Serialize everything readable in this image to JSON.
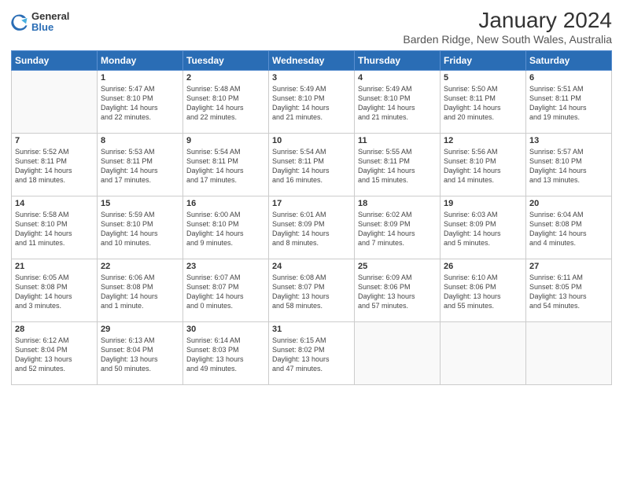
{
  "header": {
    "logo_general": "General",
    "logo_blue": "Blue",
    "title": "January 2024",
    "subtitle": "Barden Ridge, New South Wales, Australia"
  },
  "days_of_week": [
    "Sunday",
    "Monday",
    "Tuesday",
    "Wednesday",
    "Thursday",
    "Friday",
    "Saturday"
  ],
  "weeks": [
    [
      {
        "day": "",
        "info": ""
      },
      {
        "day": "1",
        "info": "Sunrise: 5:47 AM\nSunset: 8:10 PM\nDaylight: 14 hours\nand 22 minutes."
      },
      {
        "day": "2",
        "info": "Sunrise: 5:48 AM\nSunset: 8:10 PM\nDaylight: 14 hours\nand 22 minutes."
      },
      {
        "day": "3",
        "info": "Sunrise: 5:49 AM\nSunset: 8:10 PM\nDaylight: 14 hours\nand 21 minutes."
      },
      {
        "day": "4",
        "info": "Sunrise: 5:49 AM\nSunset: 8:10 PM\nDaylight: 14 hours\nand 21 minutes."
      },
      {
        "day": "5",
        "info": "Sunrise: 5:50 AM\nSunset: 8:11 PM\nDaylight: 14 hours\nand 20 minutes."
      },
      {
        "day": "6",
        "info": "Sunrise: 5:51 AM\nSunset: 8:11 PM\nDaylight: 14 hours\nand 19 minutes."
      }
    ],
    [
      {
        "day": "7",
        "info": "Sunrise: 5:52 AM\nSunset: 8:11 PM\nDaylight: 14 hours\nand 18 minutes."
      },
      {
        "day": "8",
        "info": "Sunrise: 5:53 AM\nSunset: 8:11 PM\nDaylight: 14 hours\nand 17 minutes."
      },
      {
        "day": "9",
        "info": "Sunrise: 5:54 AM\nSunset: 8:11 PM\nDaylight: 14 hours\nand 17 minutes."
      },
      {
        "day": "10",
        "info": "Sunrise: 5:54 AM\nSunset: 8:11 PM\nDaylight: 14 hours\nand 16 minutes."
      },
      {
        "day": "11",
        "info": "Sunrise: 5:55 AM\nSunset: 8:11 PM\nDaylight: 14 hours\nand 15 minutes."
      },
      {
        "day": "12",
        "info": "Sunrise: 5:56 AM\nSunset: 8:10 PM\nDaylight: 14 hours\nand 14 minutes."
      },
      {
        "day": "13",
        "info": "Sunrise: 5:57 AM\nSunset: 8:10 PM\nDaylight: 14 hours\nand 13 minutes."
      }
    ],
    [
      {
        "day": "14",
        "info": "Sunrise: 5:58 AM\nSunset: 8:10 PM\nDaylight: 14 hours\nand 11 minutes."
      },
      {
        "day": "15",
        "info": "Sunrise: 5:59 AM\nSunset: 8:10 PM\nDaylight: 14 hours\nand 10 minutes."
      },
      {
        "day": "16",
        "info": "Sunrise: 6:00 AM\nSunset: 8:10 PM\nDaylight: 14 hours\nand 9 minutes."
      },
      {
        "day": "17",
        "info": "Sunrise: 6:01 AM\nSunset: 8:09 PM\nDaylight: 14 hours\nand 8 minutes."
      },
      {
        "day": "18",
        "info": "Sunrise: 6:02 AM\nSunset: 8:09 PM\nDaylight: 14 hours\nand 7 minutes."
      },
      {
        "day": "19",
        "info": "Sunrise: 6:03 AM\nSunset: 8:09 PM\nDaylight: 14 hours\nand 5 minutes."
      },
      {
        "day": "20",
        "info": "Sunrise: 6:04 AM\nSunset: 8:08 PM\nDaylight: 14 hours\nand 4 minutes."
      }
    ],
    [
      {
        "day": "21",
        "info": "Sunrise: 6:05 AM\nSunset: 8:08 PM\nDaylight: 14 hours\nand 3 minutes."
      },
      {
        "day": "22",
        "info": "Sunrise: 6:06 AM\nSunset: 8:08 PM\nDaylight: 14 hours\nand 1 minute."
      },
      {
        "day": "23",
        "info": "Sunrise: 6:07 AM\nSunset: 8:07 PM\nDaylight: 14 hours\nand 0 minutes."
      },
      {
        "day": "24",
        "info": "Sunrise: 6:08 AM\nSunset: 8:07 PM\nDaylight: 13 hours\nand 58 minutes."
      },
      {
        "day": "25",
        "info": "Sunrise: 6:09 AM\nSunset: 8:06 PM\nDaylight: 13 hours\nand 57 minutes."
      },
      {
        "day": "26",
        "info": "Sunrise: 6:10 AM\nSunset: 8:06 PM\nDaylight: 13 hours\nand 55 minutes."
      },
      {
        "day": "27",
        "info": "Sunrise: 6:11 AM\nSunset: 8:05 PM\nDaylight: 13 hours\nand 54 minutes."
      }
    ],
    [
      {
        "day": "28",
        "info": "Sunrise: 6:12 AM\nSunset: 8:04 PM\nDaylight: 13 hours\nand 52 minutes."
      },
      {
        "day": "29",
        "info": "Sunrise: 6:13 AM\nSunset: 8:04 PM\nDaylight: 13 hours\nand 50 minutes."
      },
      {
        "day": "30",
        "info": "Sunrise: 6:14 AM\nSunset: 8:03 PM\nDaylight: 13 hours\nand 49 minutes."
      },
      {
        "day": "31",
        "info": "Sunrise: 6:15 AM\nSunset: 8:02 PM\nDaylight: 13 hours\nand 47 minutes."
      },
      {
        "day": "",
        "info": ""
      },
      {
        "day": "",
        "info": ""
      },
      {
        "day": "",
        "info": ""
      }
    ]
  ]
}
